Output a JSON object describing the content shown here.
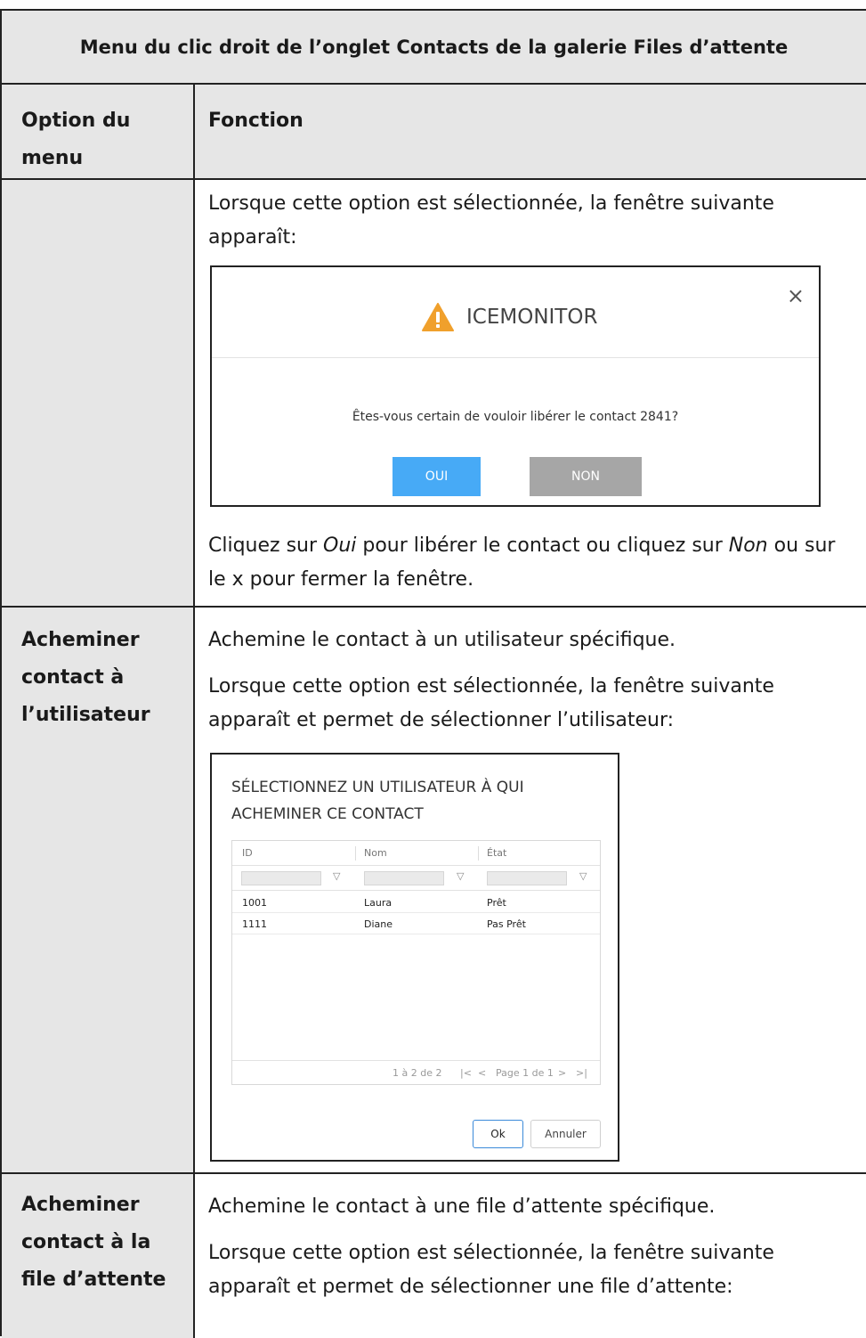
{
  "table": {
    "title": "Menu du clic droit de l’onglet Contacts de la galerie Files d’attente",
    "col_option": "Option du menu",
    "col_function": "Fonction"
  },
  "row1": {
    "intro": "Lorsque cette option est sélectionnée, la fenêtre suivante apparaît:",
    "dialog": {
      "title": "ICEMONITOR",
      "close": "×",
      "message": "Êtes-vous certain de vouloir libérer le contact 2841?",
      "yes": "OUI",
      "no": "NON"
    },
    "after": {
      "p1": "Cliquez sur ",
      "oui": "Oui",
      "p2": " pour libérer le contact ou cliquez sur ",
      "non": "Non",
      "p3": " ou sur le x pour fermer la fenêtre."
    }
  },
  "row2": {
    "option": "Acheminer contact à l’utilisateur",
    "line1": "Achemine le contact à un utilisateur spécifique.",
    "line2": "Lorsque cette option est sélectionnée, la fenêtre suivante apparaît et permet de sélectionner l’utilisateur:",
    "dialog": {
      "title": "SÉLECTIONNEZ UN UTILISATEUR À QUI ACHEMINER CE CONTACT",
      "columns": [
        "ID",
        "Nom",
        "État"
      ],
      "rows": [
        {
          "id": "1001",
          "nom": "Laura",
          "etat": "Prêt"
        },
        {
          "id": "1111",
          "nom": "Diane",
          "etat": "Pas Prêt"
        }
      ],
      "range": "1 à 2 de 2",
      "page": "Page 1 de 1",
      "ok": "Ok",
      "cancel": "Annuler"
    }
  },
  "row3": {
    "option": "Acheminer contact à la file d’attente",
    "line1": "Achemine le contact à une file d’attente spécifique.",
    "line2": "Lorsque cette option est sélectionnée, la fenêtre suivante apparaît et permet de sélectionner une file d’attente:"
  }
}
